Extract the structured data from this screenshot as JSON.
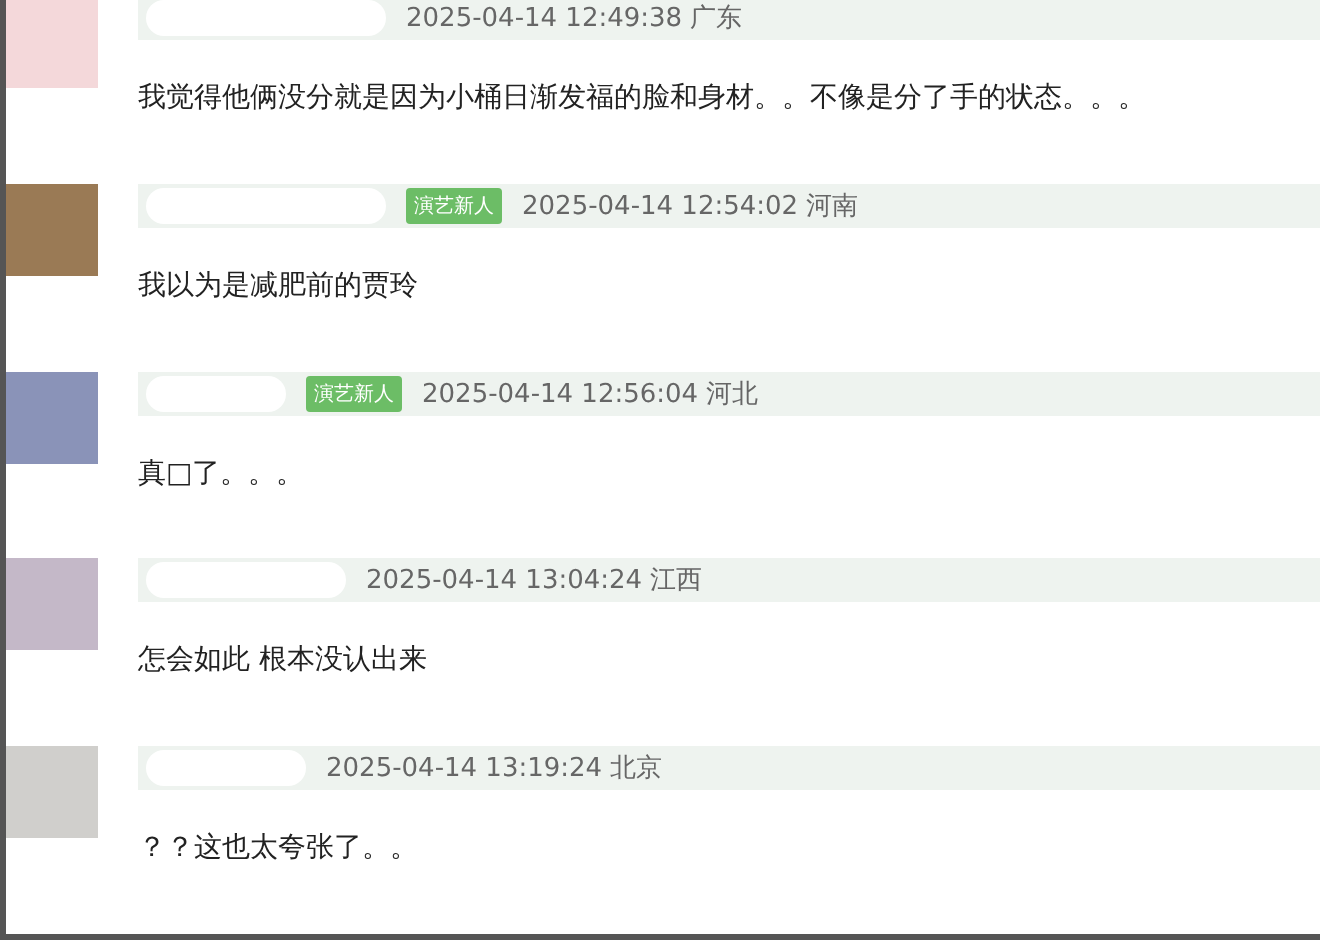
{
  "comments": [
    {
      "time": "2025-04-14 12:49:38",
      "location": "广东",
      "text": "我觉得他俩没分就是因为小桶日渐发福的脸和身材。。不像是分了手的状态。。。"
    },
    {
      "badge": "演艺新人",
      "time": "2025-04-14 12:54:02",
      "location": "河南",
      "text": "我以为是减肥前的贾玲"
    },
    {
      "badge": "演艺新人",
      "time": "2025-04-14 12:56:04",
      "location": "河北",
      "text": "真□了。。。"
    },
    {
      "time": "2025-04-14 13:04:24",
      "location": "江西",
      "text": "怎会如此 根本没认出来"
    },
    {
      "time": "2025-04-14 13:19:24",
      "location": "北京",
      "text": "？？这也太夸张了。。"
    }
  ]
}
